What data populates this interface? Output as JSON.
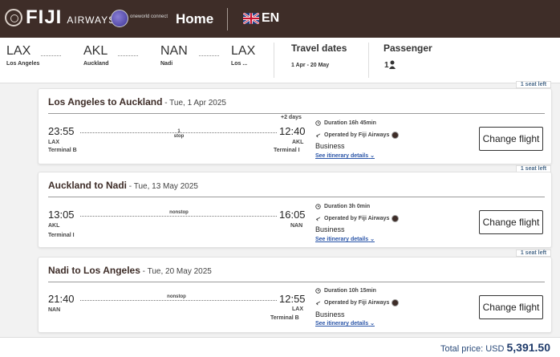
{
  "header": {
    "brand": "FIJI",
    "brand_sub": "AIRWAYS",
    "alliance": "oneworld connect",
    "home_label": "Home",
    "language": "EN",
    "colors": {
      "header_bg": "#3e2d28",
      "link": "#2a55a8",
      "total": "#1e3a6a"
    }
  },
  "summary": {
    "airports": [
      {
        "code": "LAX",
        "city": "Los Angeles"
      },
      {
        "code": "AKL",
        "city": "Auckland"
      },
      {
        "code": "NAN",
        "city": "Nadi"
      },
      {
        "code": "LAX",
        "city": "Los ..."
      }
    ],
    "travel_dates_label": "Travel dates",
    "travel_dates_value": "1 Apr - 20 May",
    "passenger_label": "Passenger",
    "passenger_count": "1"
  },
  "flights": [
    {
      "seats_left": "1 seat left",
      "route": "Los Angeles to Auckland",
      "date": " - Tue, 1 Apr 2025",
      "depart_time": "23:55",
      "depart_code": "LAX",
      "depart_terminal": "Terminal B",
      "arrive_time": "12:40",
      "arrive_code": "AKL",
      "arrive_terminal": "Terminal I",
      "day_offset": "+2 days",
      "stops_count": "1",
      "stops_label": "stop",
      "duration": "Duration 16h 45min",
      "operated_by": "Operated by Fiji Airways",
      "cabin": "Business",
      "itinerary_link": "See itinerary details",
      "change_button": "Change flight"
    },
    {
      "seats_left": "1 seat left",
      "route": "Auckland to Nadi",
      "date": " - Tue, 13 May 2025",
      "depart_time": "13:05",
      "depart_code": "AKL",
      "depart_terminal": "Terminal I",
      "arrive_time": "16:05",
      "arrive_code": "NAN",
      "arrive_terminal": "",
      "day_offset": "",
      "stops_count": "",
      "stops_label": "nonstop",
      "duration": "Duration 3h 0min",
      "operated_by": "Operated by Fiji Airways",
      "cabin": "Business",
      "itinerary_link": "See itinerary details",
      "change_button": "Change flight"
    },
    {
      "seats_left": "1 seat left",
      "route": "Nadi to Los Angeles",
      "date": " - Tue, 20 May 2025",
      "depart_time": "21:40",
      "depart_code": "NAN",
      "depart_terminal": "",
      "arrive_time": "12:55",
      "arrive_code": "LAX",
      "arrive_terminal": "Terminal B",
      "day_offset": "",
      "stops_count": "",
      "stops_label": "nonstop",
      "duration": "Duration 10h 15min",
      "operated_by": "Operated by Fiji Airways",
      "cabin": "Business",
      "itinerary_link": "See itinerary details",
      "change_button": "Change flight"
    }
  ],
  "footer": {
    "total_label": "Total price: USD",
    "total_amount": "5,391.50"
  }
}
